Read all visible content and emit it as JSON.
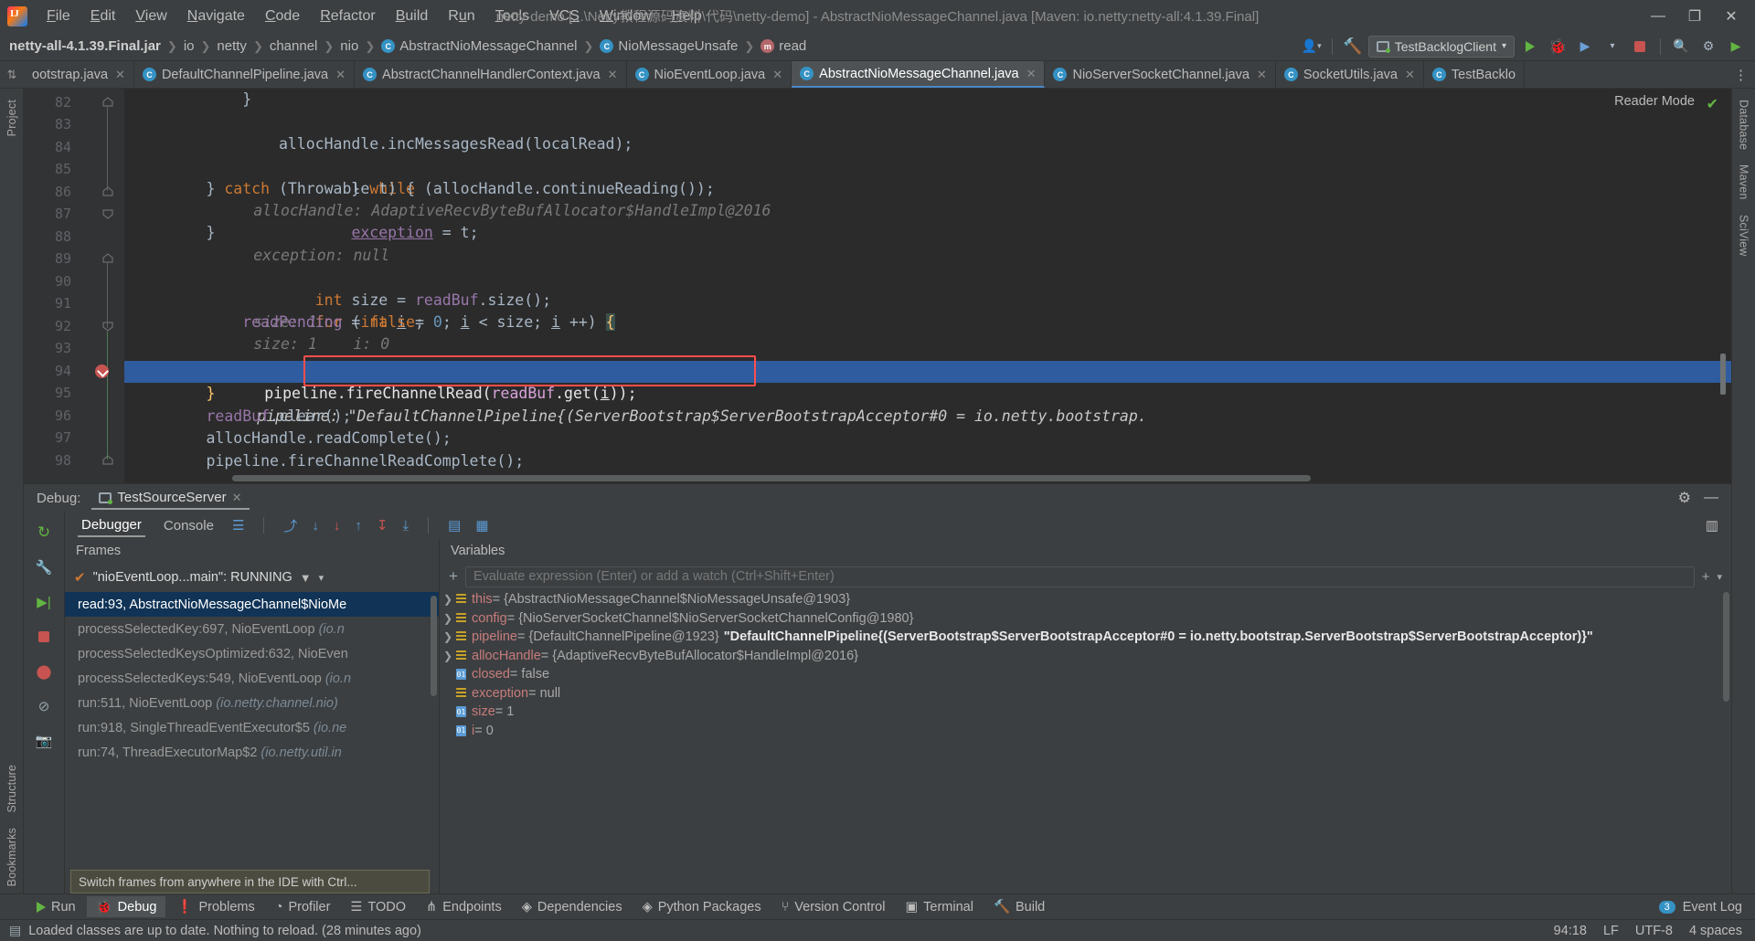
{
  "window": {
    "title": "netty-demo [...\\Netty教程源码资料\\代码\\netty-demo] - AbstractNioMessageChannel.java [Maven: io.netty:netty-all:4.1.39.Final]",
    "minimize": "—",
    "maximize": "❐",
    "close": "✕"
  },
  "menu": {
    "items": [
      {
        "label": "File"
      },
      {
        "label": "Edit"
      },
      {
        "label": "View"
      },
      {
        "label": "Navigate"
      },
      {
        "label": "Code"
      },
      {
        "label": "Refactor"
      },
      {
        "label": "Build"
      },
      {
        "label": "Run"
      },
      {
        "label": "Tools"
      },
      {
        "label": "VCS"
      },
      {
        "label": "Window"
      },
      {
        "label": "Help"
      }
    ]
  },
  "breadcrumb": {
    "items": [
      {
        "label": "netty-all-4.1.39.Final.jar",
        "icon": "",
        "bold": true
      },
      {
        "label": "io",
        "icon": ""
      },
      {
        "label": "netty",
        "icon": ""
      },
      {
        "label": "channel",
        "icon": ""
      },
      {
        "label": "nio",
        "icon": ""
      },
      {
        "label": "AbstractNioMessageChannel",
        "icon": "c"
      },
      {
        "label": "NioMessageUnsafe",
        "icon": "c"
      },
      {
        "label": "read",
        "icon": "m"
      }
    ],
    "separator": "❯"
  },
  "toolbar": {
    "run_config": "TestBacklogClient",
    "dropdown_caret": "▾",
    "account_icon": "account-icon",
    "build_icon": "build-hammer-icon",
    "search_icon": "🔍",
    "settings_icon": "⚙",
    "run_icon": "run-icon",
    "debug_icon": "debug-icon",
    "stop_icon": "stop-icon",
    "coverage_icon": "coverage-icon",
    "more_icon": "⋮"
  },
  "editor_tabs": {
    "pin_icon": "⇅",
    "overflow_icon": "⋮",
    "close_char": "✕",
    "items": [
      {
        "label": "ootstrap.java",
        "active": false,
        "icon": false
      },
      {
        "label": "DefaultChannelPipeline.java",
        "active": false,
        "icon": true
      },
      {
        "label": "AbstractChannelHandlerContext.java",
        "active": false,
        "icon": true
      },
      {
        "label": "NioEventLoop.java",
        "active": false,
        "icon": true
      },
      {
        "label": "AbstractNioMessageChannel.java",
        "active": true,
        "icon": true
      },
      {
        "label": "NioServerSocketChannel.java",
        "active": false,
        "icon": true
      },
      {
        "label": "SocketUtils.java",
        "active": false,
        "icon": true
      },
      {
        "label": "TestBacklo",
        "active": false,
        "icon": true
      }
    ]
  },
  "left_tool_tabs": [
    {
      "label": "Project"
    },
    {
      "label": "Structure"
    },
    {
      "label": "Bookmarks"
    }
  ],
  "right_tool_tabs": [
    {
      "label": "Database"
    },
    {
      "label": "Maven"
    },
    {
      "label": "SciView"
    }
  ],
  "editor": {
    "reader_mode": "Reader Mode",
    "inspection_ok": "✔",
    "highlighted_line": 93,
    "breakpoint_line": 93,
    "lines": [
      {
        "no": 82,
        "code": "            }",
        "hint": ""
      },
      {
        "no": 83,
        "code": "",
        "hint": ""
      },
      {
        "no": 84,
        "code": "                allocHandle.incMessagesRead(localRead);",
        "hint": ""
      },
      {
        "no": 85,
        "code": "            } while (allocHandle.continueReading());",
        "hint": "allocHandle: AdaptiveRecvByteBufAllocator$HandleImpl@2016"
      },
      {
        "no": 86,
        "code": "        } catch (Throwable t) {",
        "hint": ""
      },
      {
        "no": 87,
        "code": "            exception = t;",
        "hint": "exception: null"
      },
      {
        "no": 88,
        "code": "        }",
        "hint": ""
      },
      {
        "no": 89,
        "code": "",
        "hint": ""
      },
      {
        "no": 90,
        "code": "        int size = readBuf.size();",
        "hint": "size: 1"
      },
      {
        "no": 91,
        "code": "        for (int i = 0; i < size; i ++) {",
        "hint": "size: 1    i: 0"
      },
      {
        "no": 92,
        "code": "            readPending = false;",
        "hint": ""
      },
      {
        "no": 93,
        "code": "            pipeline.fireChannelRead(readBuf.get(i));",
        "hint": "pipeline: \"DefaultChannelPipeline{(ServerBootstrap$ServerBootstrapAcceptor#0 = io.netty.bootstrap."
      },
      {
        "no": 94,
        "code": "        }",
        "hint": ""
      },
      {
        "no": 95,
        "code": "        readBuf.clear();",
        "hint": ""
      },
      {
        "no": 96,
        "code": "        allocHandle.readComplete();",
        "hint": ""
      },
      {
        "no": 97,
        "code": "        pipeline.fireChannelReadComplete();",
        "hint": ""
      },
      {
        "no": 98,
        "code": "",
        "hint": ""
      }
    ]
  },
  "debug": {
    "label": "Debug:",
    "session_tab": "TestSourceServer",
    "session_close": "✕",
    "settings_icon": "⚙",
    "minimize_icon": "—",
    "layout_icon": "▥",
    "tabs": [
      {
        "label": "Debugger",
        "active": true
      },
      {
        "label": "Console",
        "active": false
      }
    ],
    "toolbar_icons": [
      "rerun-icon",
      "mute-breakpoints-icon",
      "step-over-icon",
      "step-into-icon",
      "force-step-into-icon",
      "step-out-icon",
      "drop-frame-icon",
      "run-to-cursor-icon",
      "evaluate-icon",
      "threads-icon"
    ],
    "side_icons": [
      "rerun-icon",
      "settings-wrench-icon",
      "resume-icon",
      "stop-icon",
      "mute-breakpoints-icon",
      "view-breakpoints-icon",
      "camera-icon"
    ],
    "frames": {
      "title": "Frames",
      "thread": "\"nioEventLoop...main\": RUNNING",
      "thread_check": "✔",
      "filter_icon": "▼",
      "caret_icon": "▾",
      "tooltip": "Switch frames from anywhere in the IDE with Ctrl...",
      "items": [
        {
          "method": "read:93, AbstractNioMessageChannel$NioMe",
          "pkg": "",
          "selected": true
        },
        {
          "method": "processSelectedKey:697, NioEventLoop",
          "pkg": "(io.n",
          "selected": false
        },
        {
          "method": "processSelectedKeysOptimized:632, NioEven",
          "pkg": "",
          "selected": false
        },
        {
          "method": "processSelectedKeys:549, NioEventLoop",
          "pkg": "(io.n",
          "selected": false
        },
        {
          "method": "run:511, NioEventLoop",
          "pkg": "(io.netty.channel.nio)",
          "selected": false
        },
        {
          "method": "run:918, SingleThreadEventExecutor$5",
          "pkg": "(io.ne",
          "selected": false
        },
        {
          "method": "run:74, ThreadExecutorMap$2",
          "pkg": "(io.netty.util.in",
          "selected": false
        }
      ]
    },
    "variables": {
      "title": "Variables",
      "watch_placeholder": "Evaluate expression (Enter) or add a watch (Ctrl+Shift+Enter)",
      "add_icon": "+",
      "caret_icon": "▾",
      "expand_caret": "❯",
      "items": [
        {
          "name": "this",
          "value": "= {AbstractNioMessageChannel$NioMessageUnsafe@1903}",
          "expandable": true,
          "kind": "object",
          "strong": false
        },
        {
          "name": "config",
          "value": "= {NioServerSocketChannel$NioServerSocketChannelConfig@1980}",
          "expandable": true,
          "kind": "object",
          "strong": false
        },
        {
          "name": "pipeline",
          "value": "= {DefaultChannelPipeline@1923}",
          "value2": "\"DefaultChannelPipeline{(ServerBootstrap$ServerBootstrapAcceptor#0 = io.netty.bootstrap.ServerBootstrap$ServerBootstrapAcceptor)}\"",
          "expandable": true,
          "kind": "object",
          "strong": true
        },
        {
          "name": "allocHandle",
          "value": "= {AdaptiveRecvByteBufAllocator$HandleImpl@2016}",
          "expandable": true,
          "kind": "object",
          "strong": false
        },
        {
          "name": "closed",
          "value": "= false",
          "expandable": false,
          "kind": "primitive",
          "strong": false
        },
        {
          "name": "exception",
          "value": "= null",
          "expandable": false,
          "kind": "object",
          "strong": false
        },
        {
          "name": "size",
          "value": "= 1",
          "expandable": false,
          "kind": "primitive",
          "strong": false
        },
        {
          "name": "i",
          "value": "= 0",
          "expandable": false,
          "kind": "primitive",
          "strong": false
        }
      ]
    }
  },
  "tool_windows": {
    "items": [
      {
        "label": "Run",
        "icon": "run-icon",
        "active": false
      },
      {
        "label": "Debug",
        "icon": "debug-icon",
        "active": true
      },
      {
        "label": "Problems",
        "icon": "problems-icon",
        "active": false
      },
      {
        "label": "Profiler",
        "icon": "profiler-icon",
        "active": false
      },
      {
        "label": "TODO",
        "icon": "todo-icon",
        "active": false
      },
      {
        "label": "Endpoints",
        "icon": "endpoints-icon",
        "active": false
      },
      {
        "label": "Dependencies",
        "icon": "dependencies-icon",
        "active": false
      },
      {
        "label": "Python Packages",
        "icon": "python-packages-icon",
        "active": false
      },
      {
        "label": "Version Control",
        "icon": "version-control-icon",
        "active": false
      },
      {
        "label": "Terminal",
        "icon": "terminal-icon",
        "active": false
      },
      {
        "label": "Build",
        "icon": "build-icon",
        "active": false
      }
    ],
    "event_log": "Event Log",
    "event_log_count": "3"
  },
  "statusbar": {
    "message": "Loaded classes are up to date. Nothing to reload. (28 minutes ago)",
    "position": "94:18",
    "line_sep": "LF",
    "encoding": "UTF-8",
    "indent": "4 spaces"
  }
}
